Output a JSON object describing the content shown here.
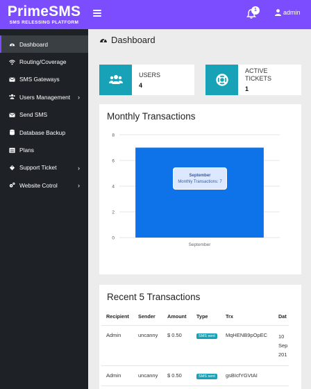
{
  "brand": {
    "title": "PrimeSMS",
    "subtitle": "SMS RELESSING PLATFORM"
  },
  "header": {
    "notifications_count": "1",
    "username": "admin"
  },
  "sidebar": {
    "items": [
      {
        "label": "Dashboard",
        "icon": "dashboard-icon",
        "active": true,
        "has_children": false
      },
      {
        "label": "Routing/Coverage",
        "icon": "wifi-icon",
        "active": false,
        "has_children": false
      },
      {
        "label": "SMS Gateways",
        "icon": "envelope-icon",
        "active": false,
        "has_children": false
      },
      {
        "label": "Users Management",
        "icon": "users-icon",
        "active": false,
        "has_children": true
      },
      {
        "label": "Send SMS",
        "icon": "envelope-icon",
        "active": false,
        "has_children": false
      },
      {
        "label": "Database Backup",
        "icon": "database-icon",
        "active": false,
        "has_children": false
      },
      {
        "label": "Plans",
        "icon": "list-icon",
        "active": false,
        "has_children": false
      },
      {
        "label": "Support Ticket",
        "icon": "ticket-icon",
        "active": false,
        "has_children": true
      },
      {
        "label": "Website Cotrol",
        "icon": "cogs-icon",
        "active": false,
        "has_children": true
      }
    ]
  },
  "page": {
    "title": "Dashboard"
  },
  "stats": [
    {
      "label": "USERS",
      "value": "4",
      "icon": "users-icon"
    },
    {
      "label": "ACTIVE TICKETS",
      "value": "1",
      "icon": "life-ring-icon"
    }
  ],
  "chart_card": {
    "title": "Monthly Transactions"
  },
  "chart_data": {
    "type": "bar",
    "categories": [
      "September"
    ],
    "series": [
      {
        "name": "Monthly Transactions",
        "values": [
          7
        ]
      }
    ],
    "ylim": [
      0,
      8
    ],
    "yticks": [
      "0",
      "2",
      "4",
      "6",
      "8"
    ],
    "grid": true,
    "color": "#0e72e8",
    "tooltip": {
      "title": "September",
      "text": "Monthly Transactions: 7"
    }
  },
  "transactions_card": {
    "title": "Recent 5 Transactions",
    "columns": [
      "Recipient",
      "Sender",
      "Amount",
      "Type",
      "Trx",
      "Dat"
    ],
    "rows": [
      {
        "recipient": "Admin",
        "sender": "uncanny",
        "amount": "$ 0.50",
        "type": "SMS sent",
        "trx": "MqHENB9pOpEC",
        "date_1": "10",
        "date_2": "Sep",
        "date_3": "201"
      },
      {
        "recipient": "Admin",
        "sender": "uncanny",
        "amount": "$ 0.50",
        "type": "SMS sent",
        "trx": "gsBIcfYGVtAI",
        "date_1": "",
        "date_2": "",
        "date_3": ""
      }
    ]
  },
  "colors": {
    "accent": "#7c4dff",
    "sidebar": "#1e2227",
    "teal": "#17a2b8",
    "bar": "#0e72e8"
  }
}
